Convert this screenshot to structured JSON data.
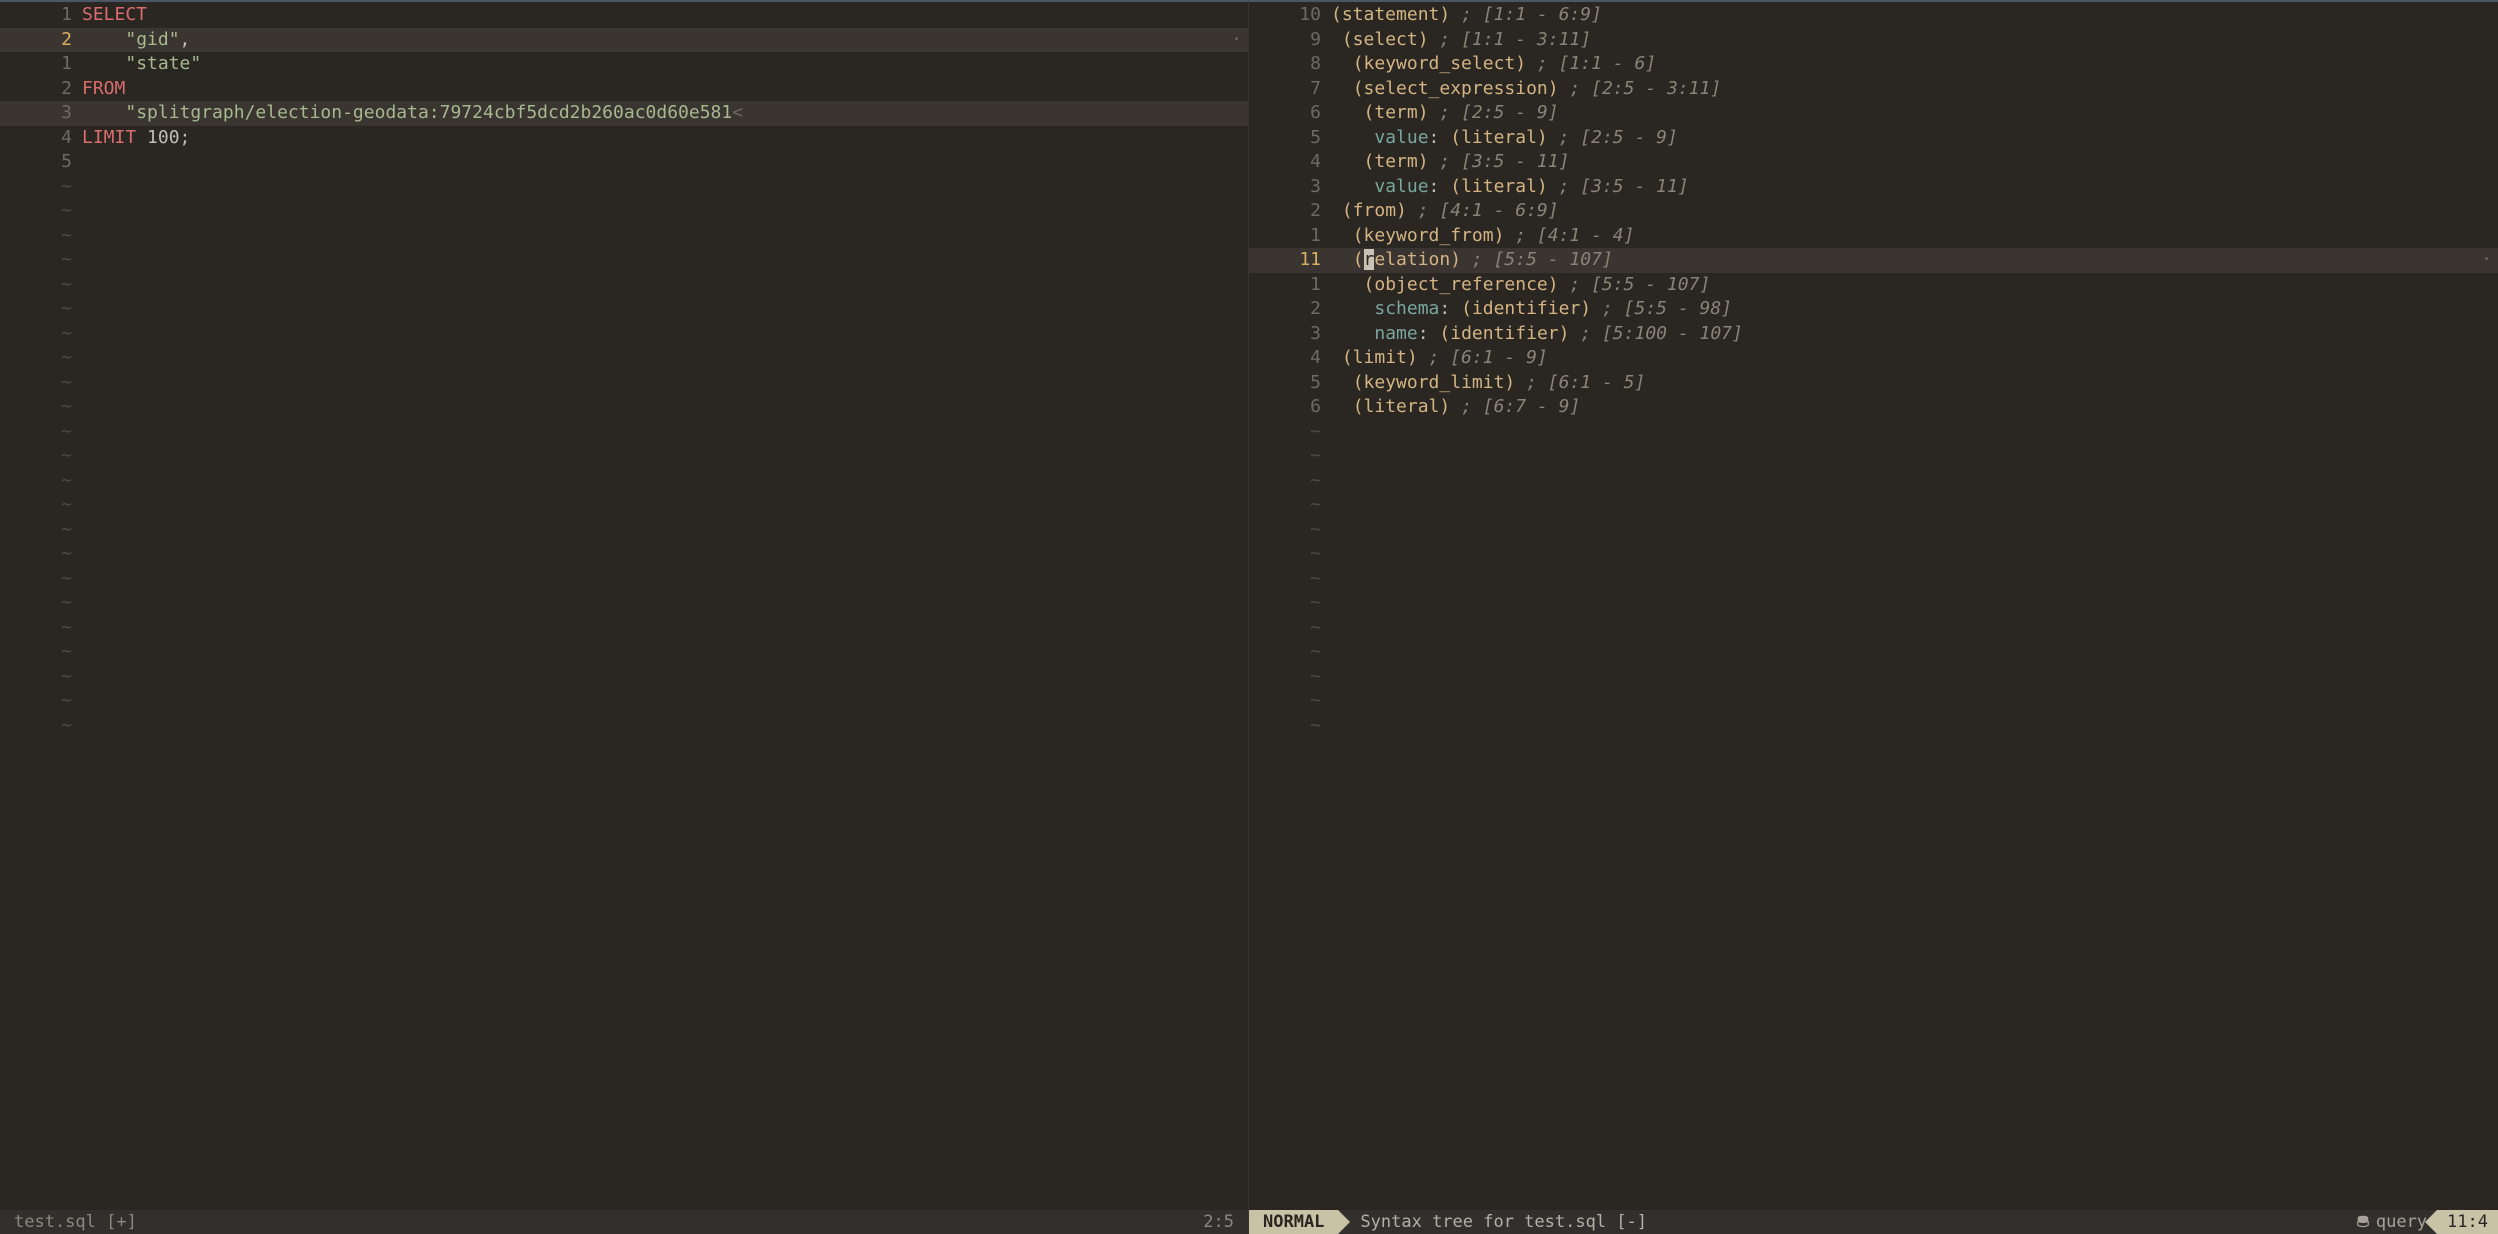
{
  "left": {
    "status_file": "test.sql [+]",
    "status_pos": "2:5",
    "lines": [
      {
        "g": "1",
        "cur": false,
        "hl": false,
        "segs": [
          {
            "c": "kw",
            "t": "SELECT"
          }
        ]
      },
      {
        "g": "2",
        "cur": true,
        "hl": true,
        "segs": [
          {
            "c": "",
            "t": "    "
          },
          {
            "c": "str",
            "t": "\"gid\""
          },
          {
            "c": "",
            "t": ","
          }
        ],
        "wrap": "·"
      },
      {
        "g": "1",
        "cur": false,
        "hl": false,
        "segs": [
          {
            "c": "",
            "t": "    "
          },
          {
            "c": "str",
            "t": "\"state\""
          }
        ]
      },
      {
        "g": "2",
        "cur": false,
        "hl": false,
        "segs": [
          {
            "c": "kw",
            "t": "FROM"
          }
        ]
      },
      {
        "g": "3",
        "cur": false,
        "hl": true,
        "segs": [
          {
            "c": "",
            "t": "    "
          },
          {
            "c": "str",
            "t": "\"splitgraph/election-geodata:79724cbf5dcd2b260ac0d60e581"
          },
          {
            "c": "trunc",
            "t": "<"
          }
        ]
      },
      {
        "g": "4",
        "cur": false,
        "hl": false,
        "segs": [
          {
            "c": "kw",
            "t": "LIMIT"
          },
          {
            "c": "",
            "t": " 100;"
          }
        ]
      },
      {
        "g": "5",
        "cur": false,
        "hl": false,
        "segs": []
      }
    ]
  },
  "right": {
    "status_mode": "NORMAL",
    "status_title": "Syntax tree for test.sql [-]",
    "status_db": "query",
    "status_pos": "11:4",
    "lines": [
      {
        "g": "10",
        "cur": false,
        "hl": false,
        "ind": 0,
        "pre": [
          {
            "c": "fn",
            "t": "(statement)"
          },
          {
            "c": "",
            "t": " "
          }
        ],
        "cmt": "; [1:1 - 6:9]"
      },
      {
        "g": "9",
        "cur": false,
        "hl": false,
        "ind": 1,
        "pre": [
          {
            "c": "fn",
            "t": "(select)"
          },
          {
            "c": "",
            "t": " "
          }
        ],
        "cmt": "; [1:1 - 3:11]"
      },
      {
        "g": "8",
        "cur": false,
        "hl": false,
        "ind": 2,
        "pre": [
          {
            "c": "fn",
            "t": "(keyword_select)"
          },
          {
            "c": "",
            "t": " "
          }
        ],
        "cmt": "; [1:1 - 6]"
      },
      {
        "g": "7",
        "cur": false,
        "hl": false,
        "ind": 2,
        "pre": [
          {
            "c": "fn",
            "t": "(select_expression)"
          },
          {
            "c": "",
            "t": " "
          }
        ],
        "cmt": "; [2:5 - 3:11]"
      },
      {
        "g": "6",
        "cur": false,
        "hl": false,
        "ind": 3,
        "pre": [
          {
            "c": "fn",
            "t": "(term)"
          },
          {
            "c": "",
            "t": " "
          }
        ],
        "cmt": "; [2:5 - 9]"
      },
      {
        "g": "5",
        "cur": false,
        "hl": false,
        "ind": 4,
        "pre": [
          {
            "c": "fld",
            "t": "value"
          },
          {
            "c": "",
            "t": ": "
          },
          {
            "c": "fn",
            "t": "(literal)"
          },
          {
            "c": "",
            "t": " "
          }
        ],
        "cmt": "; [2:5 - 9]"
      },
      {
        "g": "4",
        "cur": false,
        "hl": false,
        "ind": 3,
        "pre": [
          {
            "c": "fn",
            "t": "(term)"
          },
          {
            "c": "",
            "t": " "
          }
        ],
        "cmt": "; [3:5 - 11]"
      },
      {
        "g": "3",
        "cur": false,
        "hl": false,
        "ind": 4,
        "pre": [
          {
            "c": "fld",
            "t": "value"
          },
          {
            "c": "",
            "t": ": "
          },
          {
            "c": "fn",
            "t": "(literal)"
          },
          {
            "c": "",
            "t": " "
          }
        ],
        "cmt": "; [3:5 - 11]"
      },
      {
        "g": "2",
        "cur": false,
        "hl": false,
        "ind": 1,
        "pre": [
          {
            "c": "fn",
            "t": "(from)"
          },
          {
            "c": "",
            "t": " "
          }
        ],
        "cmt": "; [4:1 - 6:9]"
      },
      {
        "g": "1",
        "cur": false,
        "hl": false,
        "ind": 2,
        "pre": [
          {
            "c": "fn",
            "t": "(keyword_from)"
          },
          {
            "c": "",
            "t": " "
          }
        ],
        "cmt": "; [4:1 - 4]"
      },
      {
        "g": "11",
        "cur": true,
        "hl": true,
        "ind": 2,
        "pre": [
          {
            "c": "fn",
            "t": "("
          },
          {
            "c": "cursor",
            "t": "r"
          },
          {
            "c": "fn",
            "t": "elation)"
          },
          {
            "c": "",
            "t": " "
          }
        ],
        "cmt": "; [5:5 - 107]",
        "wrap": "·"
      },
      {
        "g": "1",
        "cur": false,
        "hl": false,
        "ind": 3,
        "pre": [
          {
            "c": "fn",
            "t": "(object_reference)"
          },
          {
            "c": "",
            "t": " "
          }
        ],
        "cmt": "; [5:5 - 107]"
      },
      {
        "g": "2",
        "cur": false,
        "hl": false,
        "ind": 4,
        "pre": [
          {
            "c": "fld",
            "t": "schema"
          },
          {
            "c": "",
            "t": ": "
          },
          {
            "c": "fn",
            "t": "(identifier)"
          },
          {
            "c": "",
            "t": " "
          }
        ],
        "cmt": "; [5:5 - 98]"
      },
      {
        "g": "3",
        "cur": false,
        "hl": false,
        "ind": 4,
        "pre": [
          {
            "c": "fld",
            "t": "name"
          },
          {
            "c": "",
            "t": ": "
          },
          {
            "c": "fn",
            "t": "(identifier)"
          },
          {
            "c": "",
            "t": " "
          }
        ],
        "cmt": "; [5:100 - 107]"
      },
      {
        "g": "4",
        "cur": false,
        "hl": false,
        "ind": 1,
        "pre": [
          {
            "c": "fn",
            "t": "(limit)"
          },
          {
            "c": "",
            "t": " "
          }
        ],
        "cmt": "; [6:1 - 9]"
      },
      {
        "g": "5",
        "cur": false,
        "hl": false,
        "ind": 2,
        "pre": [
          {
            "c": "fn",
            "t": "(keyword_limit)"
          },
          {
            "c": "",
            "t": " "
          }
        ],
        "cmt": "; [6:1 - 5]"
      },
      {
        "g": "6",
        "cur": false,
        "hl": false,
        "ind": 2,
        "pre": [
          {
            "c": "fn",
            "t": "(literal)"
          },
          {
            "c": "",
            "t": " "
          }
        ],
        "cmt": "; [6:7 - 9]"
      }
    ]
  },
  "tilde": "~"
}
